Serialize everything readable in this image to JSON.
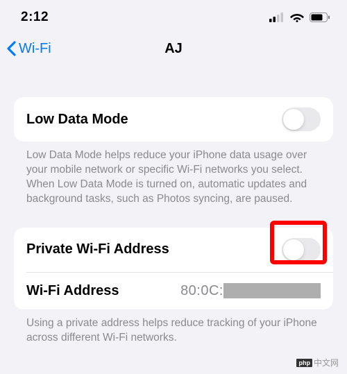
{
  "statusBar": {
    "time": "2:12"
  },
  "nav": {
    "back": "Wi-Fi",
    "title": "AJ"
  },
  "lowData": {
    "label": "Low Data Mode",
    "toggled": false,
    "footer": "Low Data Mode helps reduce your iPhone data usage over your mobile network or specific Wi-Fi networks you select. When Low Data Mode is turned on, automatic updates and background tasks, such as Photos syncing, are paused."
  },
  "privateAddr": {
    "label": "Private Wi-Fi Address",
    "toggled": false,
    "addrLabel": "Wi-Fi Address",
    "addrValue": "80:0C:",
    "footer": "Using a private address helps reduce tracking of your iPhone across different Wi-Fi networks."
  },
  "watermark": "中文网"
}
